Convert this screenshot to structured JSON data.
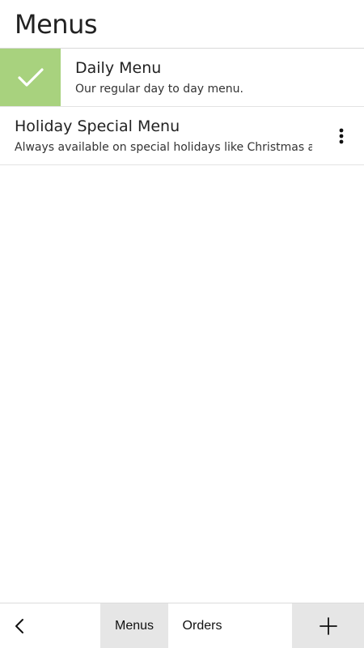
{
  "header": {
    "title": "Menus"
  },
  "menus": [
    {
      "title": "Daily Menu",
      "description": "Our regular day to day menu.",
      "selected": true
    },
    {
      "title": "Holiday Special Menu",
      "description": "Always available on special holidays like Christmas and Tl",
      "selected": false
    }
  ],
  "icons": {
    "check": "check-icon",
    "more": "more-vertical-icon",
    "back": "chevron-left-icon",
    "add": "plus-icon"
  },
  "bottom_nav": {
    "tabs": [
      {
        "label": "Menus",
        "active": true
      },
      {
        "label": "Orders",
        "active": false
      }
    ]
  },
  "colors": {
    "selected_accent": "#a8d27e",
    "active_tab_bg": "#e6e6e6",
    "add_button_bg": "#e6e6e6"
  }
}
